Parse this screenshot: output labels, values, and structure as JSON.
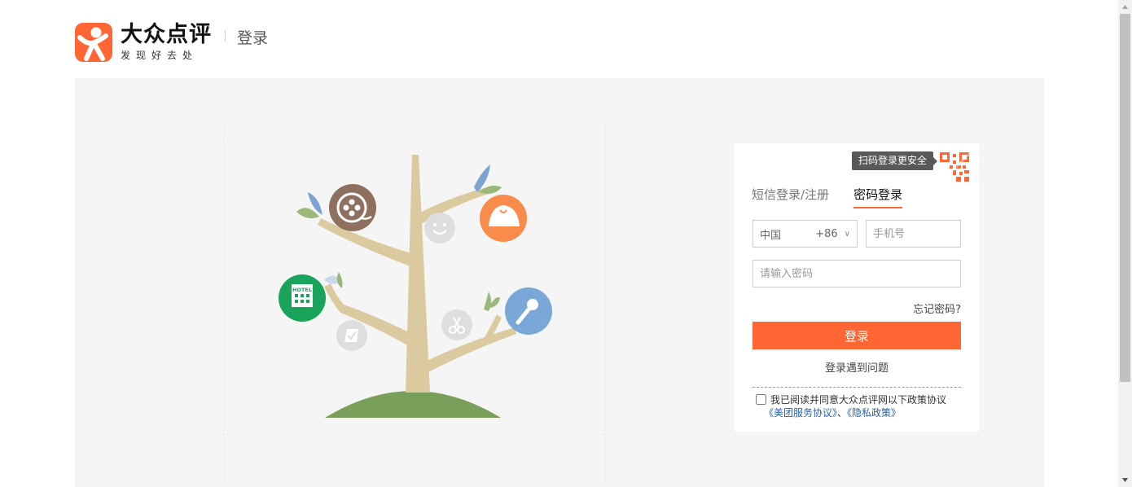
{
  "header": {
    "logo_name": "大众点评",
    "logo_slogan": "发现好去处",
    "page_title": "登录"
  },
  "illustration": {
    "hotel_label": "HOTEL",
    "icons": [
      "film-reel-icon",
      "smile-icon",
      "bun-icon",
      "hotel-icon",
      "ktv-microphone-icon",
      "scissors-icon",
      "ticket-icon"
    ]
  },
  "login": {
    "qr_tip": "扫码登录更安全",
    "tabs": [
      {
        "label": "短信登录/注册",
        "active": false
      },
      {
        "label": "密码登录",
        "active": true
      }
    ],
    "country": "中国",
    "country_code": "+86",
    "phone_placeholder": "手机号",
    "password_placeholder": "请输入密码",
    "forgot_password": "忘记密码?",
    "login_button": "登录",
    "trouble": "登录遇到问题",
    "agree_text": "我已阅读并同意大众点评网以下政策协议",
    "agree_link_1": "《美团服务协议》",
    "agree_sep": "、",
    "agree_link_2": "《隐私政策》"
  },
  "colors": {
    "brand": "#ff6633",
    "link": "#2a62a8",
    "panel_bg": "#f5f5f5"
  }
}
